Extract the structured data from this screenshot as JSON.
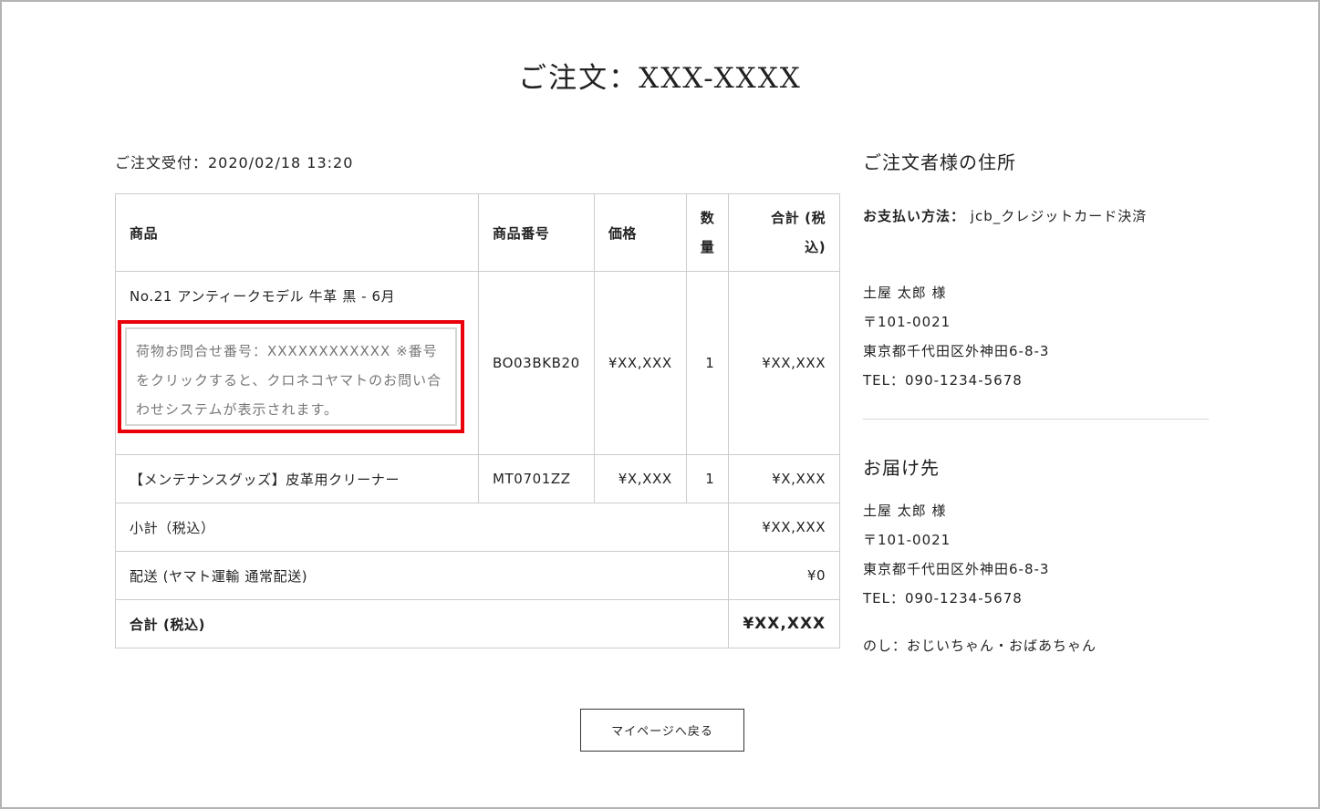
{
  "title": "ご注文：XXX-XXXX",
  "order_received": "ご注文受付：2020/02/18 13:20",
  "table": {
    "headers": {
      "product": "商品",
      "sku": "商品番号",
      "price": "価格",
      "qty_line1": "数",
      "qty_line2": "量",
      "total_line1": "合計 (税",
      "total_line2": "込)"
    },
    "rows": [
      {
        "product": "No.21 アンティークモデル 牛革 黒 - 6月",
        "sku": "BO03BKB20",
        "price": "¥XX,XXX",
        "qty": "1",
        "total": "¥XX,XXX"
      },
      {
        "product": "【メンテナンスグッズ】皮革用クリーナー",
        "sku": "MT0701ZZ",
        "price": "¥X,XXX",
        "qty": "1",
        "total": "¥X,XXX"
      }
    ],
    "tracking_note": "荷物お問合せ番号：XXXXXXXXXXXX ※番号をクリックすると、クロネコヤマトのお問い合わせシステムが表示されます。",
    "subtotal": {
      "label": "小計（税込）",
      "value": "¥XX,XXX"
    },
    "shipping": {
      "label": "配送 (ヤマト運輸 通常配送)",
      "value": "¥0"
    },
    "grand_total": {
      "label": "合計 (税込)",
      "value": "¥XX,XXX"
    }
  },
  "customer": {
    "heading": "ご注文者様の住所",
    "payment_label": "お支払い方法：",
    "payment_value": "jcb_クレジットカード決済",
    "name": "土屋 太郎 様",
    "postal": "〒101-0021",
    "address": "東京都千代田区外神田6-8-3",
    "tel": "TEL：090-1234-5678"
  },
  "shipping_to": {
    "heading": "お届け先",
    "name": "土屋 太郎 様",
    "postal": "〒101-0021",
    "address": "東京都千代田区外神田6-8-3",
    "tel": "TEL：090-1234-5678",
    "noshi": "のし：おじいちゃん・おばあちゃん"
  },
  "back_button": "マイページへ戻る",
  "colors": {
    "highlight": "#e8000b",
    "border": "#cccccc"
  }
}
